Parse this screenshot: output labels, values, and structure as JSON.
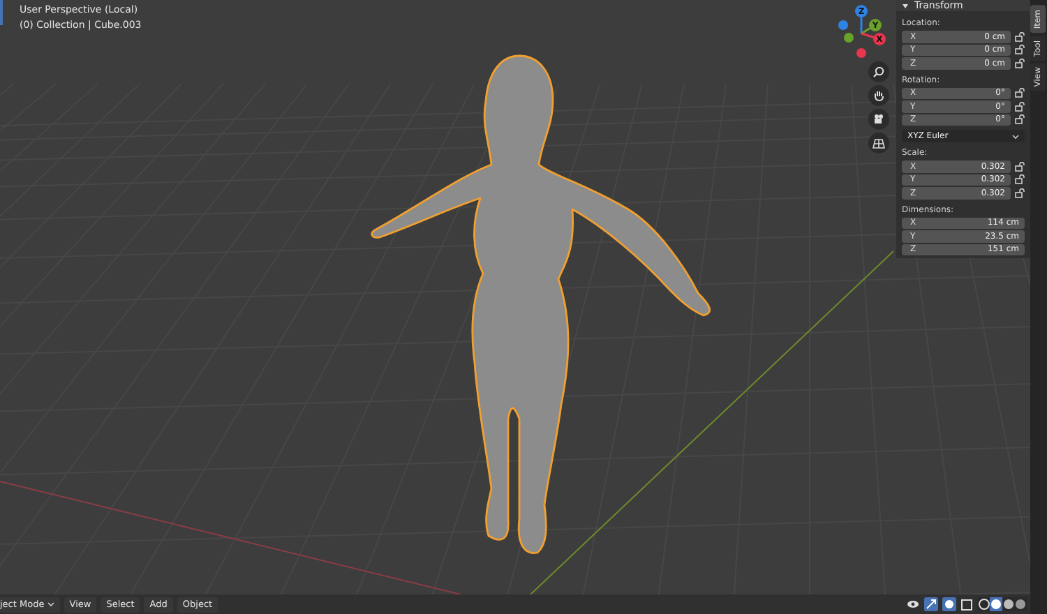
{
  "viewport": {
    "view_name": "User Perspective (Local)",
    "collection": "(0) Collection | Cube.003"
  },
  "gizmo": {
    "axes": [
      {
        "label": "Z",
        "color": "#2f83e4"
      },
      {
        "label": "Y",
        "color": "#6aa12a"
      },
      {
        "label": "X",
        "color": "#e8364f"
      }
    ]
  },
  "sidebar": {
    "panel_title": "Transform",
    "expanded": true,
    "items": [
      {
        "kind": "section",
        "label": "Location:",
        "fields": [
          {
            "axis": "X",
            "value": "0 cm",
            "locked": false
          },
          {
            "axis": "Y",
            "value": "0 cm",
            "locked": false
          },
          {
            "axis": "Z",
            "value": "0 cm",
            "locked": false
          }
        ]
      },
      {
        "kind": "section",
        "label": "Rotation:",
        "fields": [
          {
            "axis": "X",
            "value": "0°",
            "locked": false
          },
          {
            "axis": "Y",
            "value": "0°",
            "locked": false
          },
          {
            "axis": "Z",
            "value": "0°",
            "locked": false
          }
        ]
      },
      {
        "kind": "dropdown",
        "value": "XYZ Euler"
      },
      {
        "kind": "section",
        "label": "Scale:",
        "fields": [
          {
            "axis": "X",
            "value": "0.302",
            "locked": false
          },
          {
            "axis": "Y",
            "value": "0.302",
            "locked": false
          },
          {
            "axis": "Z",
            "value": "0.302",
            "locked": false
          }
        ]
      },
      {
        "kind": "section",
        "label": "Dimensions:",
        "fields": [
          {
            "axis": "X",
            "value": "114 cm"
          },
          {
            "axis": "Y",
            "value": "23.5 cm"
          },
          {
            "axis": "Z",
            "value": "151 cm"
          }
        ]
      }
    ],
    "tabs": [
      {
        "label": "Item",
        "selected": true
      },
      {
        "label": "Tool",
        "selected": false
      },
      {
        "label": "View",
        "selected": false
      }
    ]
  },
  "header": {
    "mode": "ject Mode",
    "menus": [
      "View",
      "Select",
      "Add",
      "Object"
    ]
  }
}
